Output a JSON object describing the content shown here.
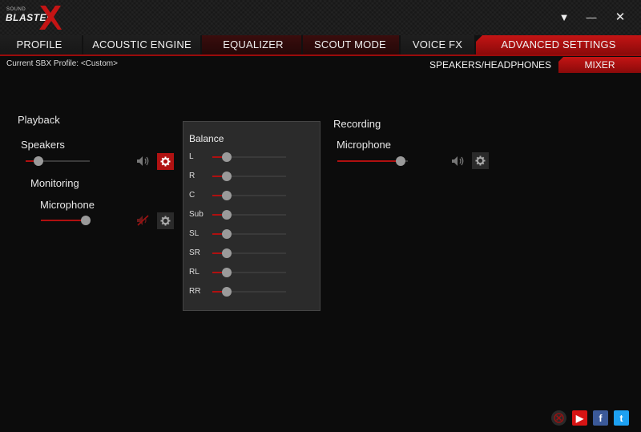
{
  "app": {
    "logo_small": "SOUND",
    "logo_word": "BLASTER"
  },
  "window_controls": {
    "dropdown": "▼",
    "minimize": "—",
    "close": "✕"
  },
  "tabs": [
    {
      "label": "PROFILE"
    },
    {
      "label": "ACOUSTIC ENGINE"
    },
    {
      "label": "EQUALIZER"
    },
    {
      "label": "SCOUT MODE"
    },
    {
      "label": "VOICE FX"
    },
    {
      "label": "ADVANCED SETTINGS"
    }
  ],
  "profile": {
    "label": "Current SBX Profile: <Custom>"
  },
  "subtabs": [
    {
      "label": "SPEAKERS/HEADPHONES"
    },
    {
      "label": "MIXER"
    }
  ],
  "playback": {
    "section_label": "Playback",
    "speakers_label": "Speakers",
    "speakers_level": 0.2,
    "monitoring_label": "Monitoring",
    "monitor_mic_label": "Microphone",
    "monitor_mic_level": 1.0
  },
  "recording": {
    "section_label": "Recording",
    "mic_label": "Microphone",
    "mic_level": 0.9
  },
  "balance": {
    "title": "Balance",
    "channels": [
      {
        "label": "L",
        "level": 0.2
      },
      {
        "label": "R",
        "level": 0.2
      },
      {
        "label": "C",
        "level": 0.2
      },
      {
        "label": "Sub",
        "level": 0.2
      },
      {
        "label": "SL",
        "level": 0.2
      },
      {
        "label": "SR",
        "level": 0.2
      },
      {
        "label": "RL",
        "level": 0.2
      },
      {
        "label": "RR",
        "level": 0.2
      }
    ]
  },
  "social": {
    "youtube": "▶",
    "facebook": "f",
    "twitter": "t"
  },
  "colors": {
    "accent": "#b01010",
    "background": "#0c0c0c"
  }
}
